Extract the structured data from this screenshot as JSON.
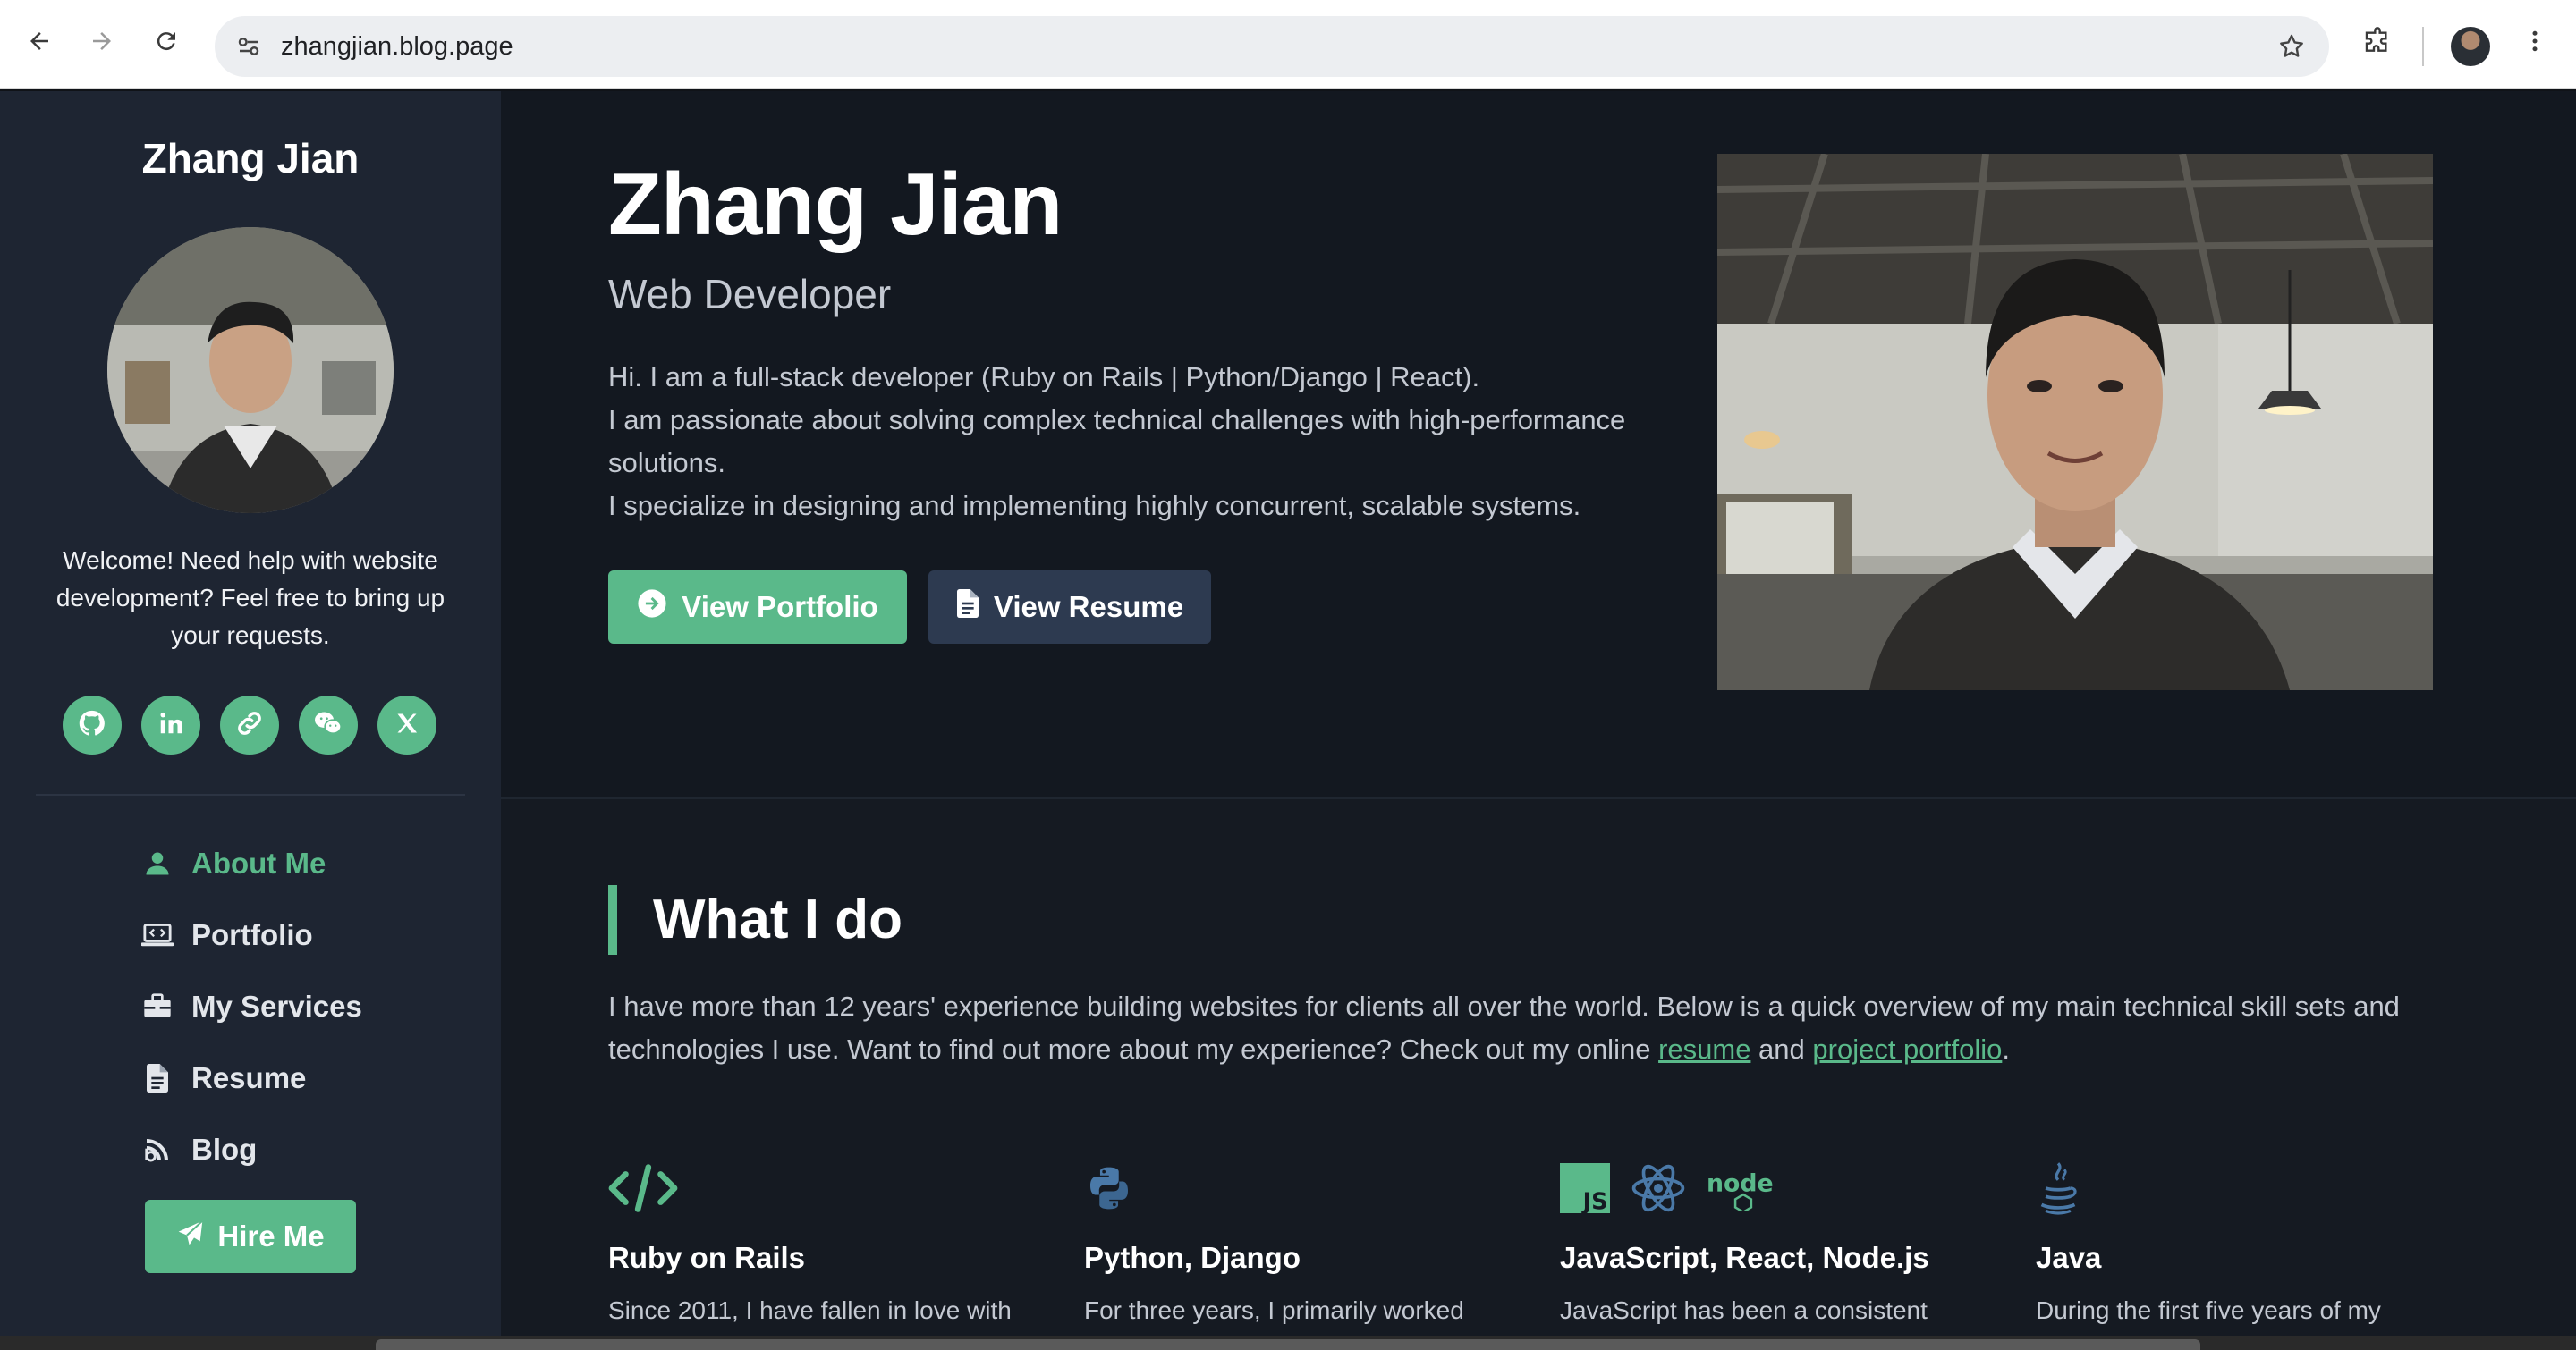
{
  "browser": {
    "url": "zhangjian.blog.page"
  },
  "sidebar": {
    "name": "Zhang Jian",
    "welcome": "Welcome! Need help with website development? Feel free to bring up your requests.",
    "social": [
      "github-icon",
      "linkedin-icon",
      "link-icon",
      "wechat-icon",
      "x-icon"
    ],
    "nav": [
      {
        "label": "About Me",
        "icon": "user-icon",
        "active": true
      },
      {
        "label": "Portfolio",
        "icon": "laptop-code-icon"
      },
      {
        "label": "My Services",
        "icon": "briefcase-icon"
      },
      {
        "label": "Resume",
        "icon": "file-icon"
      },
      {
        "label": "Blog",
        "icon": "blog-icon"
      }
    ],
    "hire_label": "Hire Me"
  },
  "hero": {
    "name": "Zhang Jian",
    "title": "Web Developer",
    "bio": [
      "Hi. I am a full-stack developer (Ruby on Rails | Python/Django | React).",
      "I am passionate about solving complex technical challenges with high-performance solutions.",
      "I specialize in designing and implementing highly concurrent, scalable systems."
    ],
    "portfolio_label": "View Portfolio",
    "resume_label": "View Resume"
  },
  "what_i_do": {
    "title": "What I do",
    "desc_before": "I have more than 12 years' experience building websites for clients all over the world. Below is a quick overview of my main technical skill sets and technologies I use. Want to find out more about my experience? Check out my online ",
    "resume_link": "resume",
    "and": " and ",
    "portfolio_link": "project portfolio",
    "desc_end": ".",
    "skills": [
      {
        "title": "Ruby on Rails",
        "text": "Since 2011, I have fallen in love with"
      },
      {
        "title": "Python, Django",
        "text": "For three years, I primarily worked"
      },
      {
        "title": "JavaScript, React, Node.js",
        "text": "JavaScript has been a consistent"
      },
      {
        "title": "Java",
        "text": "During the first five years of my"
      }
    ]
  },
  "colors": {
    "accent": "#5ab98a",
    "sidebar_bg": "#1e2532",
    "main_bg": "#131820"
  }
}
